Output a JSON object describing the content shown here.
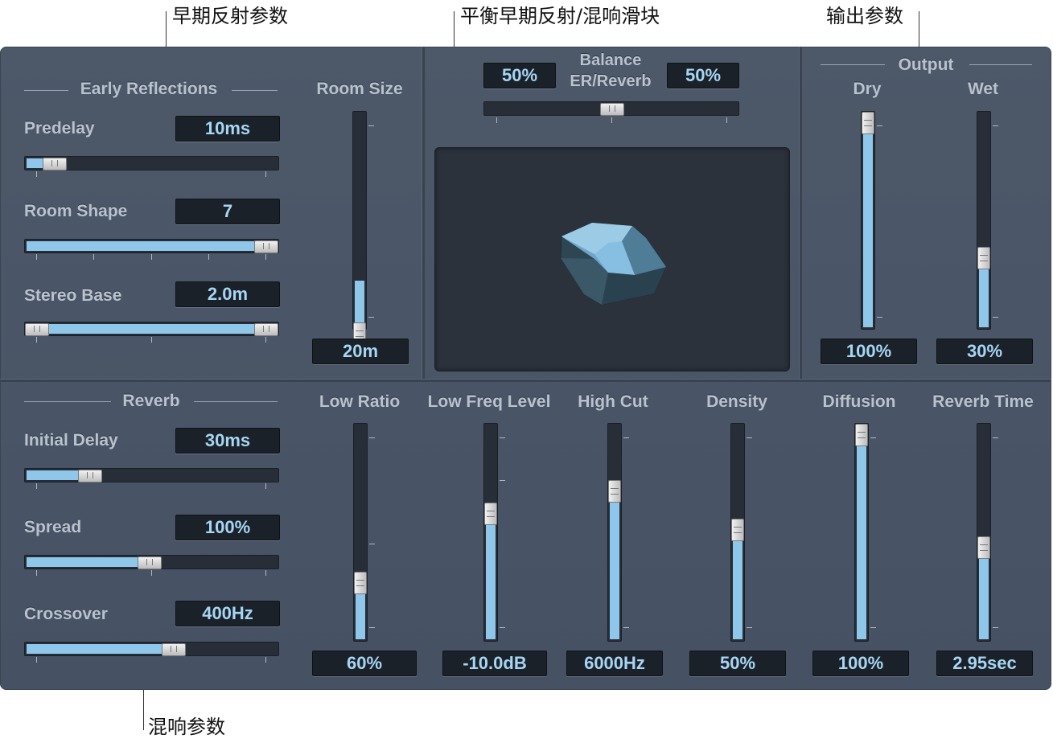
{
  "callouts": {
    "early_reflections": "早期反射参数",
    "balance_slider": "平衡早期反射/混响滑块",
    "output": "输出参数",
    "reverb": "混响参数"
  },
  "early_reflections": {
    "section_title": "Early Reflections",
    "predelay": {
      "label": "Predelay",
      "value": "10ms",
      "level": 0.05
    },
    "room_shape": {
      "label": "Room Shape",
      "value": "7",
      "level": 1.0
    },
    "stereo_base": {
      "label": "Stereo Base",
      "value": "2.0m"
    },
    "room_size": {
      "label": "Room Size",
      "value": "20m",
      "level": 0.22
    }
  },
  "balance": {
    "label_line1": "Balance",
    "label_line2": "ER/Reverb",
    "er_value": "50%",
    "reverb_value": "50%",
    "level": 0.5
  },
  "output": {
    "section_title": "Output",
    "dry": {
      "label": "Dry",
      "value": "100%",
      "level": 1.0
    },
    "wet": {
      "label": "Wet",
      "value": "30%",
      "level": 0.3
    }
  },
  "reverb": {
    "section_title": "Reverb",
    "initial_delay": {
      "label": "Initial Delay",
      "value": "30ms",
      "level": 0.22
    },
    "spread": {
      "label": "Spread",
      "value": "100%",
      "level": 0.5
    },
    "crossover": {
      "label": "Crossover",
      "value": "400Hz",
      "level": 0.6
    },
    "faders": [
      {
        "label": "Low Ratio",
        "value": "60%",
        "level": 0.2
      },
      {
        "label": "Low Freq Level",
        "value": "-10.0dB",
        "level": 0.6
      },
      {
        "label": "High Cut",
        "value": "6000Hz",
        "level": 0.7
      },
      {
        "label": "Density",
        "value": "50%",
        "level": 0.5
      },
      {
        "label": "Diffusion",
        "value": "100%",
        "level": 1.0
      },
      {
        "label": "Reverb Time",
        "value": "2.95sec",
        "level": 0.42
      }
    ]
  },
  "colors": {
    "panel": "#4a5567",
    "fill": "#8fc7ea",
    "value_text": "#a6d6f4",
    "label_text": "#b9c2cf"
  }
}
